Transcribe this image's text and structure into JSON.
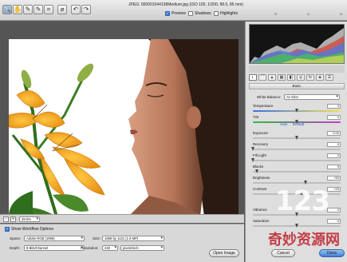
{
  "window": {
    "title": "JPEG: 000001544138Medium.jpg (ISO 100, 1/200, f/8.0, 85 mm)"
  },
  "toolbar": {
    "tools": [
      "zoom-tool",
      "hand-tool",
      "white-balance-tool",
      "color-sampler-tool",
      "crop-tool",
      "straighten-tool",
      "rotate-left-tool",
      "rotate-right-tool"
    ],
    "tool_glyphs": [
      "🔍",
      "✋",
      "✎",
      "✎",
      "⌗",
      "⌀",
      "↶",
      "↷"
    ],
    "preview_label": "Preview",
    "preview_checked": true,
    "shadows_label": "Shadows",
    "shadows_checked": false,
    "highlights_label": "Highlights",
    "highlights_checked": false
  },
  "rgb_readout": {
    "r": "R:",
    "g": "G:",
    "b": "B:"
  },
  "viewer": {
    "zoom_value": "39.5%",
    "zoom_out": "-",
    "zoom_in": "+"
  },
  "workflow": {
    "show_label": "Show Workflow Options",
    "space_label": "Space:",
    "space_value": "Adobe RGB (1998)",
    "depth_label": "Depth:",
    "depth_value": "8 Bits/Channel",
    "size_label": "Size:",
    "size_value": "1698 by 1131 (1.9 MP)",
    "resolution_label": "Resolution:",
    "resolution_value": "240",
    "resolution_unit": "pixels/inch"
  },
  "panel": {
    "section": "Basic",
    "white_balance_label": "White Balance:",
    "white_balance_value": "As Shot",
    "auto_link": "Auto",
    "default_link": "Default",
    "sliders": [
      {
        "name": "Temperature",
        "value": "0",
        "position": 0.5,
        "track": "linear-gradient(90deg,#3a6ee8,#f4e24a)"
      },
      {
        "name": "Tint",
        "value": "0",
        "position": 0.5,
        "track": "linear-gradient(90deg,#2fbd3a,#c33cc8)"
      },
      {
        "name": "Exposure",
        "value": "0.00",
        "position": 0.5,
        "track": "#bdbdbd"
      },
      {
        "name": "Recovery",
        "value": "0",
        "position": 0.0,
        "track": "#bdbdbd"
      },
      {
        "name": "Fill Light",
        "value": "0",
        "position": 0.0,
        "track": "#bdbdbd"
      },
      {
        "name": "Blacks",
        "value": "5",
        "position": 0.05,
        "track": "#bdbdbd"
      },
      {
        "name": "Brightness",
        "value": "+50",
        "position": 0.6,
        "track": "#bdbdbd"
      },
      {
        "name": "Contrast",
        "value": "+25",
        "position": 0.56,
        "track": "#bdbdbd"
      },
      {
        "name": "Vibrance",
        "value": "0",
        "position": 0.5,
        "track": "#bdbdbd"
      },
      {
        "name": "Saturation",
        "value": "0",
        "position": 0.5,
        "track": "#bdbdbd"
      }
    ]
  },
  "buttons": {
    "open": "Open Image",
    "cancel": "Cancel",
    "done": "Done"
  },
  "watermark": {
    "digits": "123",
    "text": "奇妙资源网"
  }
}
